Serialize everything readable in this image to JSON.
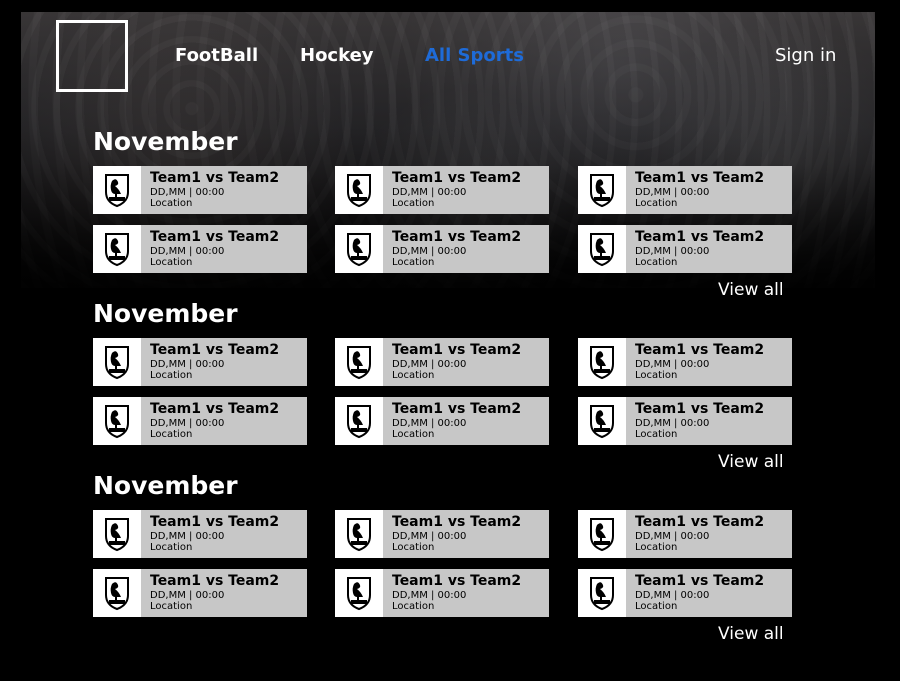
{
  "nav": {
    "links": [
      "FootBall",
      "Hockey",
      "All Sports"
    ],
    "active_link": "All Sports",
    "signin": "Sign in",
    "active_color": "#1e6bd8"
  },
  "sections": [
    {
      "title": "November",
      "view_all": "View all",
      "matches": [
        {
          "title": "Team1 vs Team2",
          "datetime": "DD,MM | 00:00",
          "location": "Location"
        },
        {
          "title": "Team1 vs Team2",
          "datetime": "DD,MM | 00:00",
          "location": "Location"
        },
        {
          "title": "Team1 vs Team2",
          "datetime": "DD,MM | 00:00",
          "location": "Location"
        },
        {
          "title": "Team1 vs Team2",
          "datetime": "DD,MM | 00:00",
          "location": "Location"
        },
        {
          "title": "Team1 vs Team2",
          "datetime": "DD,MM | 00:00",
          "location": "Location"
        },
        {
          "title": "Team1 vs Team2",
          "datetime": "DD,MM | 00:00",
          "location": "Location"
        }
      ]
    },
    {
      "title": "November",
      "view_all": "View all",
      "matches": [
        {
          "title": "Team1 vs Team2",
          "datetime": "DD,MM | 00:00",
          "location": "Location"
        },
        {
          "title": "Team1 vs Team2",
          "datetime": "DD,MM | 00:00",
          "location": "Location"
        },
        {
          "title": "Team1 vs Team2",
          "datetime": "DD,MM | 00:00",
          "location": "Location"
        },
        {
          "title": "Team1 vs Team2",
          "datetime": "DD,MM | 00:00",
          "location": "Location"
        },
        {
          "title": "Team1 vs Team2",
          "datetime": "DD,MM | 00:00",
          "location": "Location"
        },
        {
          "title": "Team1 vs Team2",
          "datetime": "DD,MM | 00:00",
          "location": "Location"
        }
      ]
    },
    {
      "title": "November",
      "view_all": "View all",
      "matches": [
        {
          "title": "Team1 vs Team2",
          "datetime": "DD,MM | 00:00",
          "location": "Location"
        },
        {
          "title": "Team1 vs Team2",
          "datetime": "DD,MM | 00:00",
          "location": "Location"
        },
        {
          "title": "Team1 vs Team2",
          "datetime": "DD,MM | 00:00",
          "location": "Location"
        },
        {
          "title": "Team1 vs Team2",
          "datetime": "DD,MM | 00:00",
          "location": "Location"
        },
        {
          "title": "Team1 vs Team2",
          "datetime": "DD,MM | 00:00",
          "location": "Location"
        },
        {
          "title": "Team1 vs Team2",
          "datetime": "DD,MM | 00:00",
          "location": "Location"
        }
      ]
    }
  ],
  "icons": {
    "team_badge": "flamingo-crest-icon"
  },
  "colors": {
    "background": "#000000",
    "card": "#c7c7c7",
    "text": "#ffffff",
    "card_text": "#000000"
  }
}
